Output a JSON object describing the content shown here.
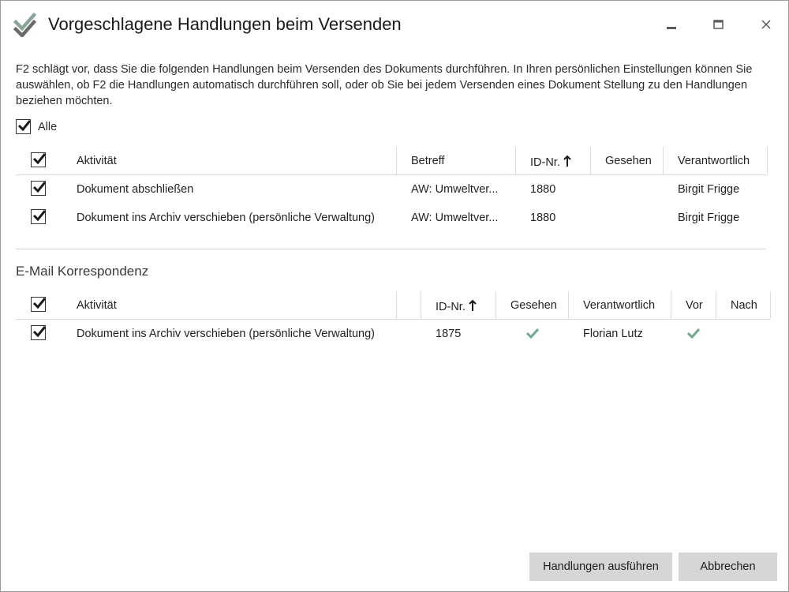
{
  "window": {
    "title": "Vorgeschlagene Handlungen beim Versenden",
    "controls": {
      "minimize": "minimize-icon",
      "maximize": "maximize-icon",
      "close": "close-icon"
    }
  },
  "description": "F2 schlägt vor, dass Sie die folgenden Handlungen beim Versenden des Dokuments durchführen. In Ihren persönlichen Einstellungen können Sie auswählen, ob F2 die Handlungen automatisch durchführen soll, oder ob Sie bei jedem Versenden eines Dokument Stellung zu den Handlungen beziehen möchten.",
  "select_all": {
    "label": "Alle",
    "checked": true
  },
  "table1": {
    "columns": {
      "activity": "Aktivität",
      "subject": "Betreff",
      "id": "ID-Nr.",
      "seen": "Gesehen",
      "responsible": "Verantwortlich"
    },
    "sort_indicator": "arrow-up-icon",
    "rows": [
      {
        "checked": true,
        "activity": "Dokument abschließen",
        "subject": "AW: Umweltver...",
        "id": "1880",
        "seen": "",
        "responsible": "Birgit Frigge"
      },
      {
        "checked": true,
        "activity": "Dokument ins Archiv verschieben (persönliche Verwaltung)",
        "subject": "AW: Umweltver...",
        "id": "1880",
        "seen": "",
        "responsible": "Birgit Frigge"
      }
    ]
  },
  "section2": {
    "title": "E-Mail Korrespondenz"
  },
  "table2": {
    "columns": {
      "activity": "Aktivität",
      "id": "ID-Nr.",
      "seen": "Gesehen",
      "responsible": "Verantwortlich",
      "before": "Vor",
      "after": "Nach"
    },
    "rows": [
      {
        "checked": true,
        "activity": "Dokument ins Archiv verschieben (persönliche Verwaltung)",
        "id": "1875",
        "seen": true,
        "responsible": "Florian Lutz",
        "before": true,
        "after": false
      }
    ]
  },
  "buttons": {
    "execute": "Handlungen ausführen",
    "cancel": "Abbrechen"
  },
  "colors": {
    "accent_check": "#6fa88a",
    "button_bg": "#d6d6d6"
  }
}
